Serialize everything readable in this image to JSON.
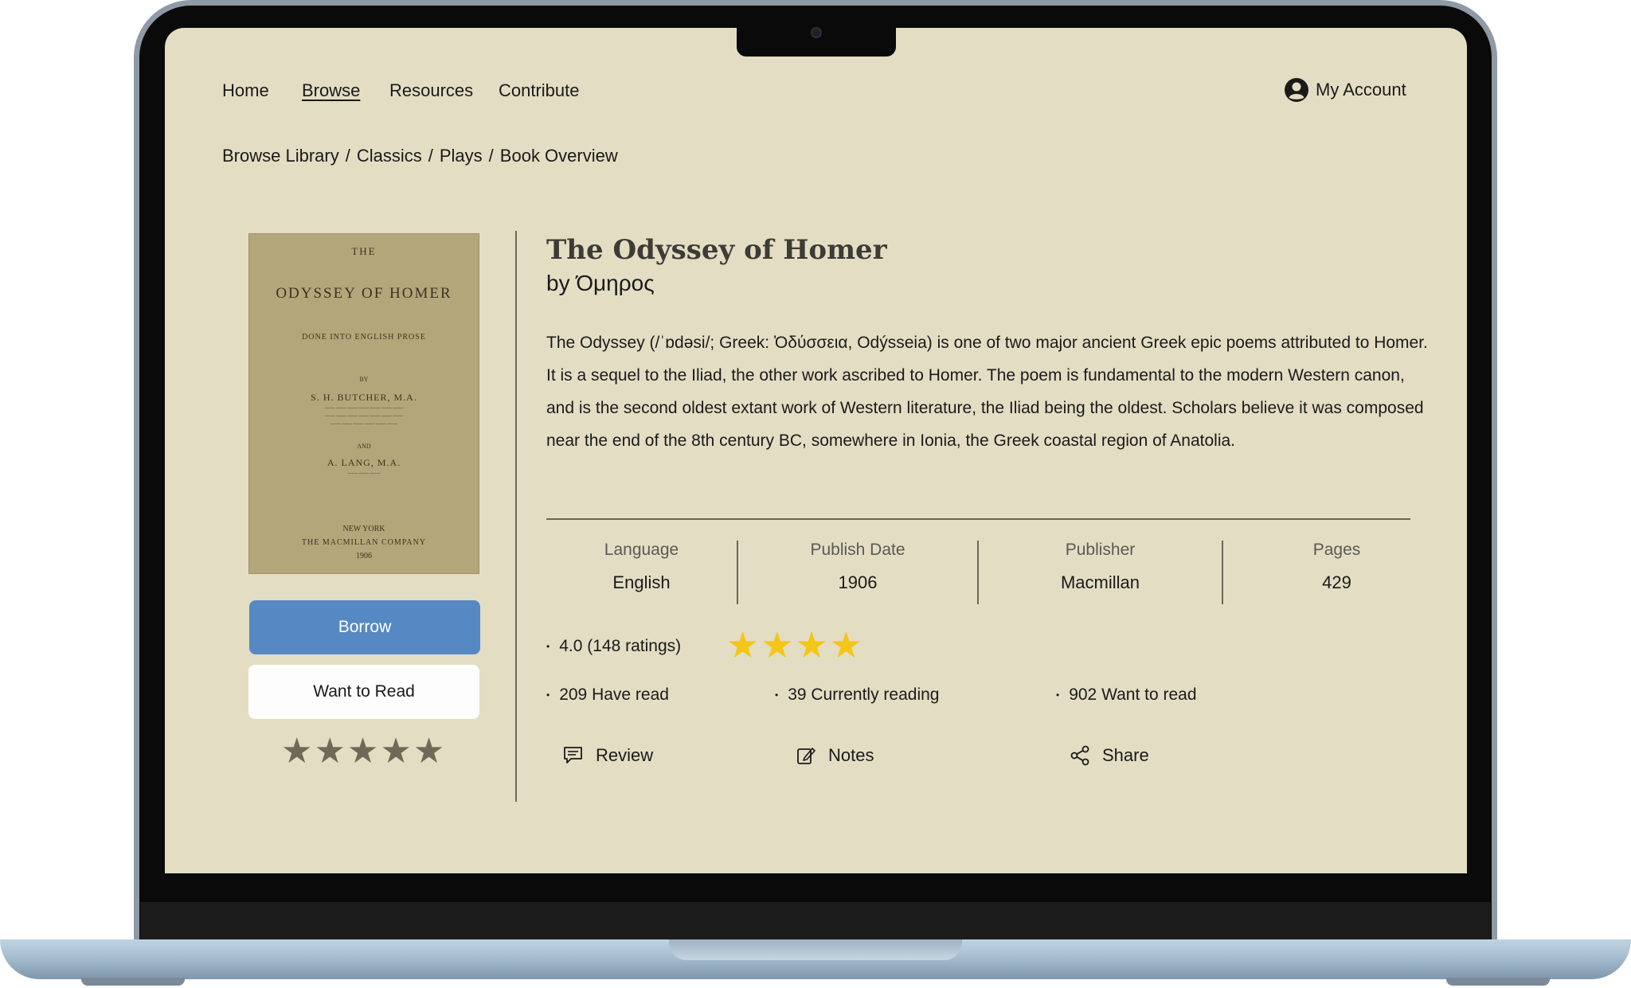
{
  "nav": {
    "links": [
      "Home",
      "Browse",
      "Resources",
      "Contribute"
    ],
    "active": "Browse",
    "account_label": "My Account"
  },
  "breadcrumb": [
    "Browse Library",
    "/",
    "Classics",
    "/",
    "Plays",
    "/",
    "Book Overview"
  ],
  "cover": {
    "the": "THE",
    "title": "ODYSSEY OF HOMER",
    "subtitle": "DONE INTO ENGLISH PROSE",
    "by": "BY",
    "author1": "S. H. BUTCHER, M.A.",
    "and": "AND",
    "author2": "A. LANG, M.A.",
    "city": "NEW YORK",
    "publisher": "THE MACMILLAN COMPANY",
    "year": "1906"
  },
  "actions_left": {
    "borrow_label": "Borrow",
    "want_label": "Want to Read",
    "rating_stars": 5
  },
  "book": {
    "title": "The Odyssey of Homer",
    "author": "by Όμηρος",
    "description": "The Odyssey (/ˈɒdəsi/; Greek: Ὀδύσσεια, Odýsseia) is one of two major ancient Greek epic poems attributed to Homer. It is a sequel to the Iliad, the other work ascribed to Homer. The poem is fundamental to the modern Western canon, and is the second oldest extant work of Western literature, the Iliad being the oldest. Scholars believe it was composed near the end of the 8th century BC, somewhere in Ionia, the Greek coastal region of Anatolia."
  },
  "meta": {
    "language_label": "Language",
    "language_value": "English",
    "date_label": "Publish Date",
    "date_value": "1906",
    "publisher_label": "Publisher",
    "publisher_value": "Macmillan",
    "pages_label": "Pages",
    "pages_value": "429"
  },
  "stats": {
    "rating": "4.0 (148 ratings)",
    "rating_value": 4.0,
    "have_read": "209 Have read",
    "currently_reading": "39 Currently reading",
    "want_to_read": "902 Want to read"
  },
  "actions": {
    "review": "Review",
    "notes": "Notes",
    "share": "Share"
  },
  "colors": {
    "page_bg": "#e3ddc3",
    "borrow_bg": "#5689c3",
    "star_gold": "#f5c518",
    "star_grey": "#6f6a57",
    "divider": "#6b6753"
  },
  "icons": [
    "account-icon",
    "review-icon",
    "notes-icon",
    "share-icon",
    "star-icon"
  ]
}
